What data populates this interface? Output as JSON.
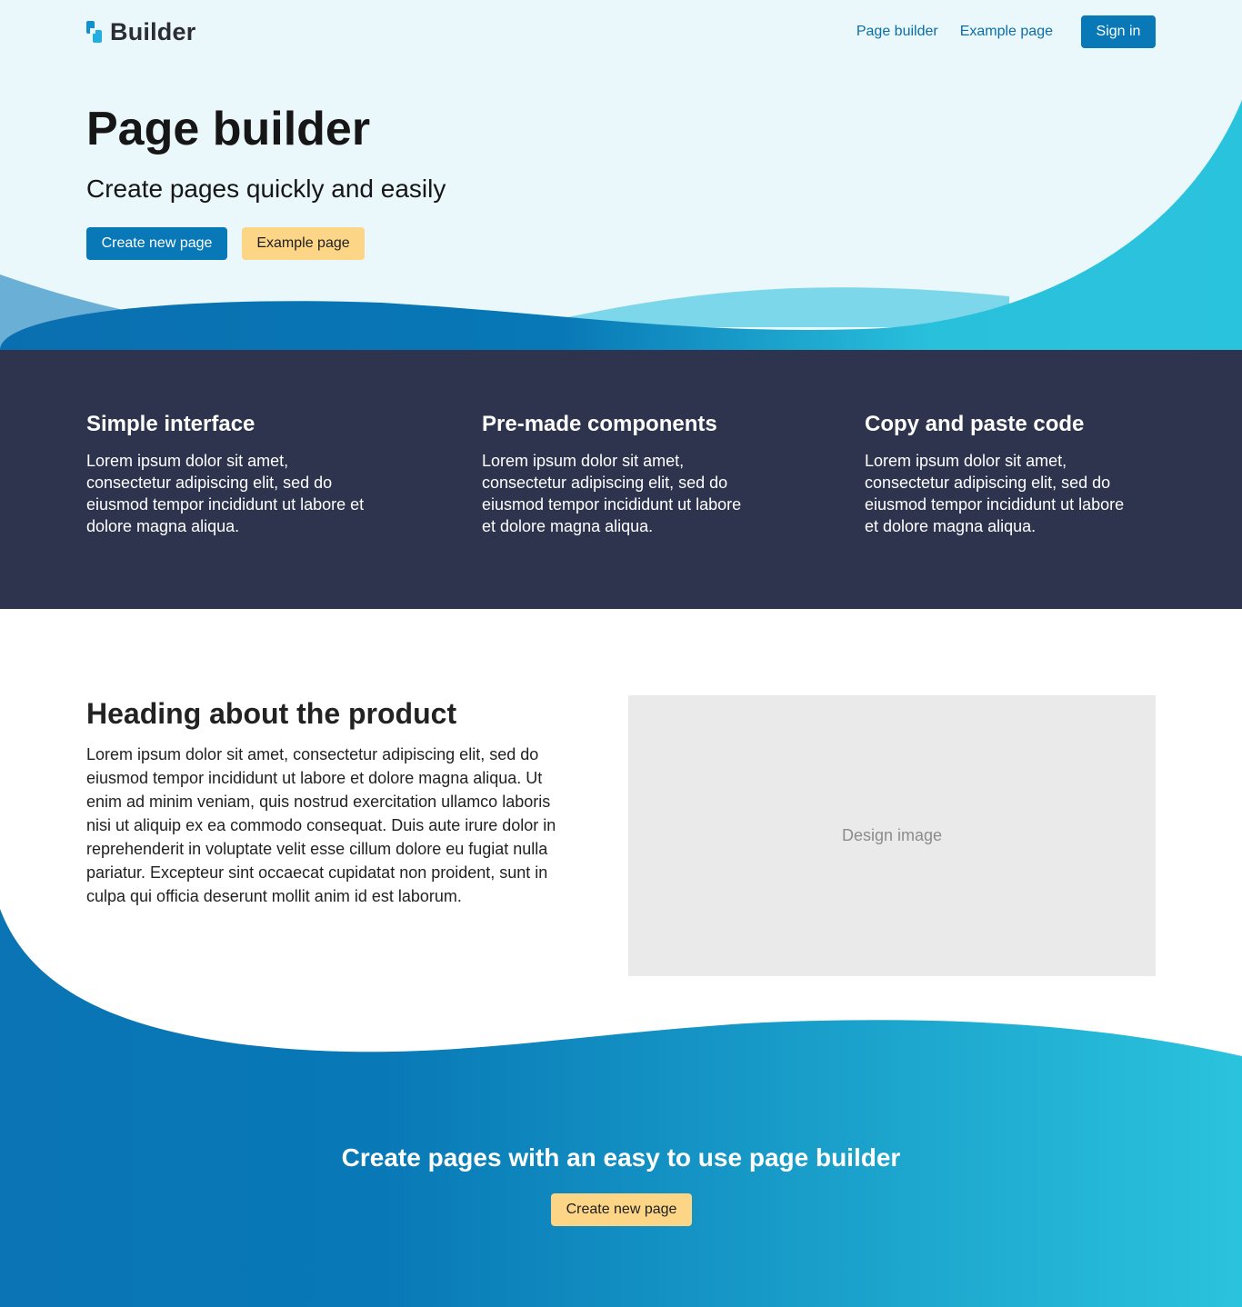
{
  "header": {
    "logo_text": "Builder",
    "nav": {
      "page_builder": "Page builder",
      "example_page": "Example page"
    },
    "sign_in": "Sign in"
  },
  "hero": {
    "title": "Page builder",
    "subtitle": "Create pages quickly and easily",
    "primary_button": "Create new page",
    "secondary_button": "Example page"
  },
  "features": [
    {
      "title": "Simple interface",
      "text": "Lorem ipsum dolor sit amet, consectetur adipiscing elit, sed do eiusmod tempor incididunt ut labore et dolore magna aliqua."
    },
    {
      "title": "Pre-made components",
      "text": "Lorem ipsum dolor sit amet, consectetur adipiscing elit, sed do eiusmod tempor incididunt ut labore et dolore magna aliqua."
    },
    {
      "title": "Copy and paste code",
      "text": "Lorem ipsum dolor sit amet, consectetur adipiscing elit, sed do eiusmod tempor incididunt ut labore et dolore magna aliqua."
    }
  ],
  "product": {
    "heading": "Heading about the product",
    "text": "Lorem ipsum dolor sit amet, consectetur adipiscing elit, sed do eiusmod tempor incididunt ut labore et dolore magna aliqua. Ut enim ad minim veniam, quis nostrud exercitation ullamco laboris nisi ut aliquip ex ea commodo consequat. Duis aute irure dolor in reprehenderit in voluptate velit esse cillum dolore eu fugiat nulla pariatur. Excepteur sint occaecat cupidatat non proident, sunt in culpa qui officia deserunt mollit anim id est laborum.",
    "image_placeholder": "Design image"
  },
  "cta": {
    "heading": "Create pages with an easy to use page builder",
    "button": "Create new page"
  },
  "colors": {
    "primary": "#0878b6",
    "accent": "#fcd587",
    "dark_band": "#2e344d",
    "hero_bg": "#eaf7fb",
    "cyan": "#29c0dc"
  },
  "icons": {
    "logo": "builder-logo-icon"
  }
}
